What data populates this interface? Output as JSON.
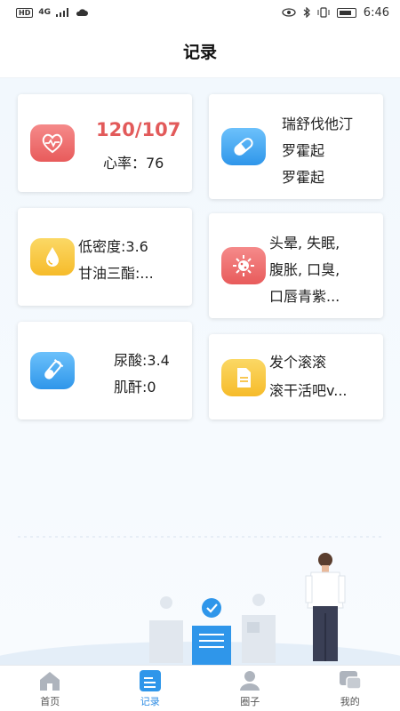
{
  "status_bar": {
    "network_left": "HD",
    "signal": "4G",
    "time": "6:46"
  },
  "header": {
    "title": "记录"
  },
  "cards": {
    "blood_pressure": {
      "value": "120/107",
      "heart_rate": "心率：76",
      "icon": "heart-pulse-icon",
      "color": "#f06a6a"
    },
    "medication": {
      "line1": "瑞舒伐他汀",
      "line2": "罗霍起",
      "line3": "罗霍起",
      "icon": "pill-icon",
      "color": "#3aa0f0"
    },
    "lipids": {
      "line1": "低密度:3.6",
      "line2": "甘油三酯:...",
      "icon": "droplet-icon",
      "color": "#f8c93e"
    },
    "symptoms": {
      "line1": "头晕, 失眠,",
      "line2": "腹胀, 口臭,",
      "line3": "口唇青紫...",
      "icon": "virus-icon",
      "color": "#f06a6a"
    },
    "kidney": {
      "line1": "尿酸:3.4",
      "line2": "肌酐:0",
      "icon": "test-tube-icon",
      "color": "#3aa0f0"
    },
    "notes": {
      "line1": "发个滚滚",
      "line2": "滚干活吧v...",
      "icon": "note-icon",
      "color": "#f8c93e"
    }
  },
  "tabbar": {
    "items": [
      {
        "label": "首页",
        "icon": "home-icon"
      },
      {
        "label": "记录",
        "icon": "record-icon",
        "active": true
      },
      {
        "label": "圈子",
        "icon": "community-icon"
      },
      {
        "label": "我的",
        "icon": "profile-icon"
      }
    ]
  }
}
